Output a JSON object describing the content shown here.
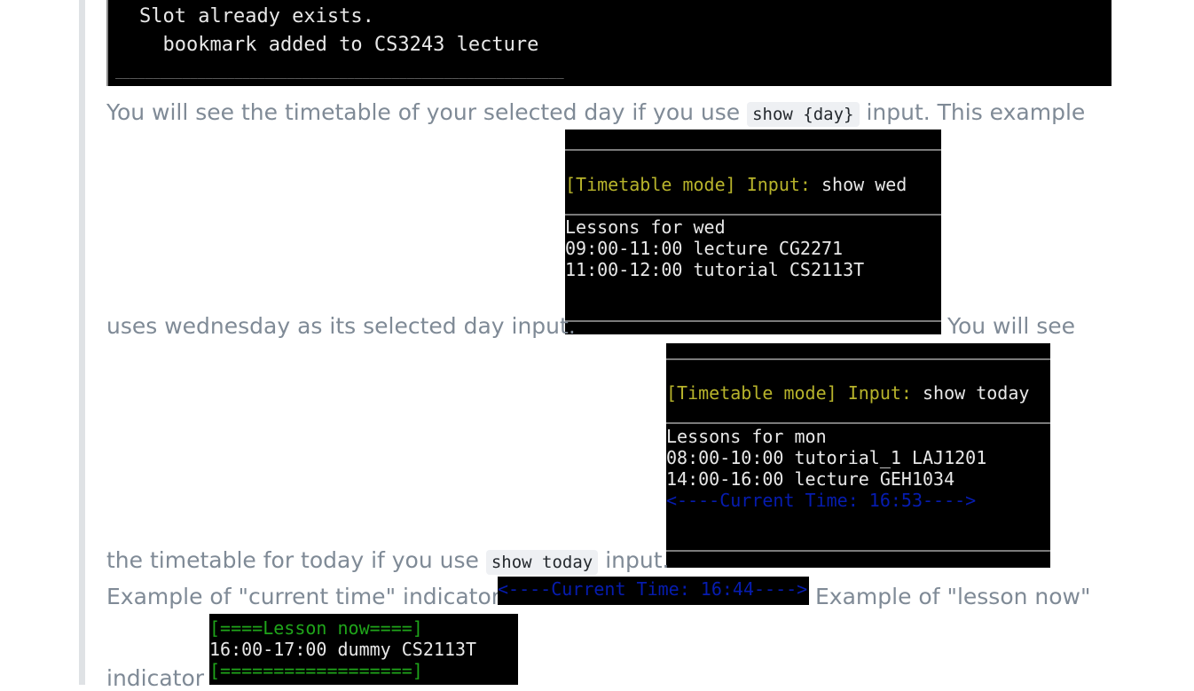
{
  "top_terminal": {
    "line1": "Slot already exists.",
    "line2": "  bookmark added to CS3243 lecture",
    "dashes": "____________________________________________________________"
  },
  "para1": {
    "before": "You will see the timetable of your selected day if you use ",
    "code": "show {day}",
    "after": " input. This example"
  },
  "para2": {
    "text": "uses wednesday as its selected day input.",
    "trailing": "You will see"
  },
  "term_wed": {
    "prompt": "[Timetable mode] Input:",
    "command": " show wed",
    "lines": [
      "Lessons for wed",
      "09:00-11:00 lecture CG2271",
      "11:00-12:00 tutorial CS2113T"
    ]
  },
  "term_today": {
    "prompt": "[Timetable mode] Input:",
    "command": " show today",
    "lines": [
      "Lessons for mon",
      "08:00-10:00 tutorial_1 LAJ1201",
      "14:00-16:00 lecture GEH1034"
    ],
    "current_time": "<----Current Time: 16:53---->"
  },
  "para3": {
    "before": "the timetable for today if you use ",
    "code": "show today",
    "after": " input."
  },
  "para4": {
    "before": "Example of \"current time\" indicator",
    "indicator": "<----Current Time: 16:44---->",
    "after": "Example of \"lesson now\""
  },
  "para5": {
    "text": "indicator"
  },
  "term_lesson_now": {
    "header": "[====Lesson now====]",
    "line": "16:00-17:00 dummy CS2113T",
    "footer": "[==================]"
  }
}
